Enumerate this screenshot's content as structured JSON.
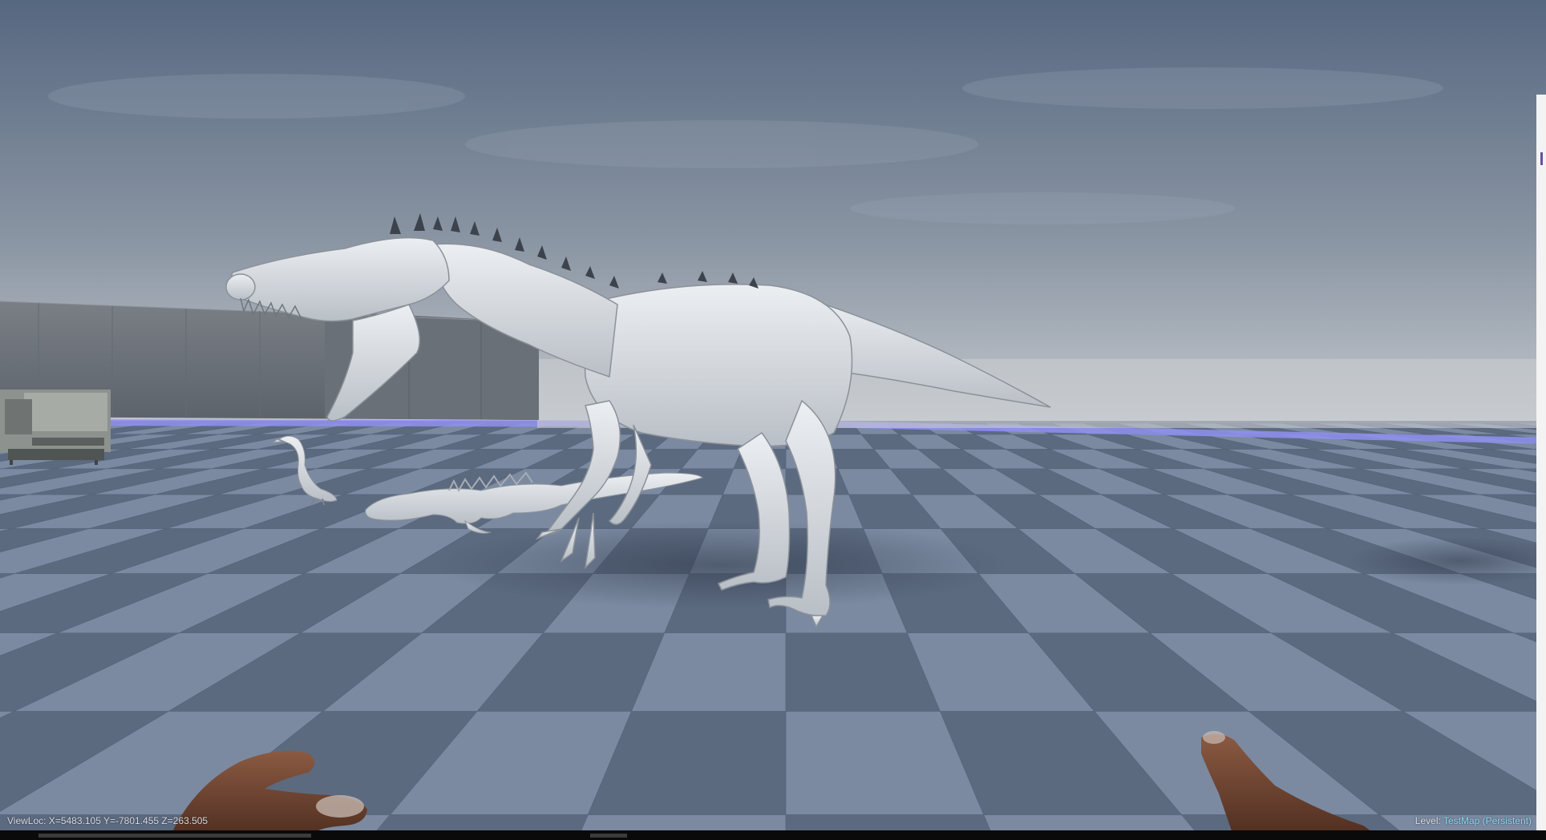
{
  "hud": {
    "viewloc": "ViewLoc: X=5483.105 Y=-7801.455 Z=263.505",
    "level_label": "Level:",
    "level_name": "TestMap (Persistent)"
  },
  "colors": {
    "sky_top": "#5e6f86",
    "sky_horizon": "#c4c9ce",
    "floor_light": "#7b8aa1",
    "floor_dark": "#5c6a80",
    "horizon_glow": "#8f8ff0",
    "creature_clay": "#d9dde2",
    "hud_text": "#d6dae0",
    "hud_level": "#8fd3ef"
  },
  "icons": {
    "left_hand": "left-hand-icon",
    "right_hand": "right-hand-icon"
  }
}
